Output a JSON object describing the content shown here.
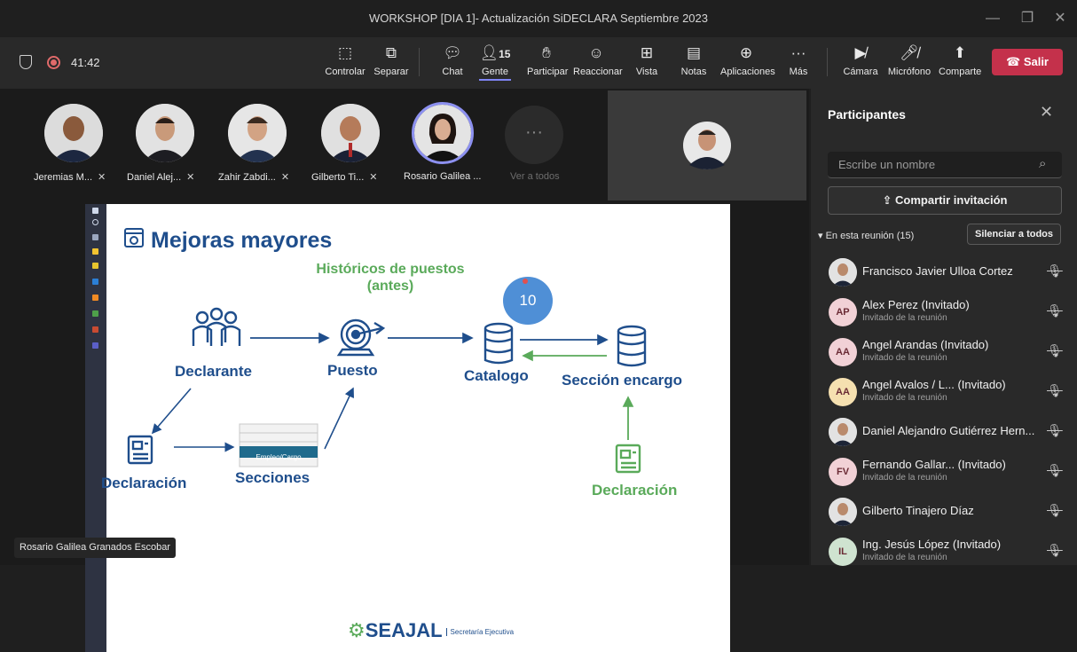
{
  "window": {
    "title": "WORKSHOP [DIA 1]- Actualización SiDECLARA Septiembre 2023"
  },
  "meeting": {
    "timer": "41:42"
  },
  "toolbar": {
    "controlar": "Controlar",
    "separar": "Separar",
    "chat": "Chat",
    "gente": "Gente",
    "gente_count": "15",
    "participar": "Participar",
    "reaccionar": "Reaccionar",
    "vista": "Vista",
    "notas": "Notas",
    "aplicaciones": "Aplicaciones",
    "mas": "Más",
    "camara": "Cámara",
    "microfono": "Micrófono",
    "comparte": "Comparte",
    "salir": "Salir"
  },
  "gallery": {
    "people": [
      {
        "name": "Jeremias M..."
      },
      {
        "name": "Daniel Alej..."
      },
      {
        "name": "Zahir Zabdi..."
      },
      {
        "name": "Gilberto Ti..."
      },
      {
        "name": "Rosario Galilea ..."
      }
    ],
    "see_all": "Ver a todos"
  },
  "slide": {
    "title": "Mejoras mayores",
    "subtitle": "Históricos de puestos (antes)",
    "badge": "10",
    "declarante": "Declarante",
    "puesto": "Puesto",
    "catalogo": "Catalogo",
    "seccion_encargo": "Sección encargo",
    "declaracion_left": "Declaración",
    "secciones": "Secciones",
    "empleo_cargo": "Empleo/Cargo",
    "declaracion_right": "Declaración",
    "logo": "SEAJAL",
    "logo_sub": "Secretaría Ejecutiva"
  },
  "presenter": {
    "name": "Rosario Galilea Granados Escobar"
  },
  "panel": {
    "title": "Participantes",
    "search_placeholder": "Escribe un nombre",
    "share_invite": "Compartir invitación",
    "section": "En esta reunión (15)",
    "mute_all": "Silenciar a todos",
    "participants": [
      {
        "name": "Francisco Javier Ulloa Cortez",
        "sub": "",
        "initials": "",
        "photo": true
      },
      {
        "name": "Alex Perez (Invitado)",
        "sub": "Invitado de la reunión",
        "initials": "AP",
        "color": "#f1d1d6"
      },
      {
        "name": "Angel Arandas (Invitado)",
        "sub": "Invitado de la reunión",
        "initials": "AA",
        "color": "#f1d1d6"
      },
      {
        "name": "Angel Avalos / L... (Invitado)",
        "sub": "Invitado de la reunión",
        "initials": "AA",
        "color": "#f5e0b0"
      },
      {
        "name": "Daniel Alejandro Gutiérrez Hern...",
        "sub": "",
        "initials": "",
        "photo": true
      },
      {
        "name": "Fernando Gallar... (Invitado)",
        "sub": "Invitado de la reunión",
        "initials": "FV",
        "color": "#f1d1d6"
      },
      {
        "name": "Gilberto Tinajero Díaz",
        "sub": "",
        "initials": "",
        "photo": true
      },
      {
        "name": "Ing. Jesús López (Invitado)",
        "sub": "Invitado de la reunión",
        "initials": "IL",
        "color": "#cfe3d0"
      }
    ]
  },
  "colors": {
    "accent": "#7f85f5",
    "leave": "#c4314b",
    "slide_blue": "#1f4e8c",
    "slide_green": "#5aaa5a"
  }
}
